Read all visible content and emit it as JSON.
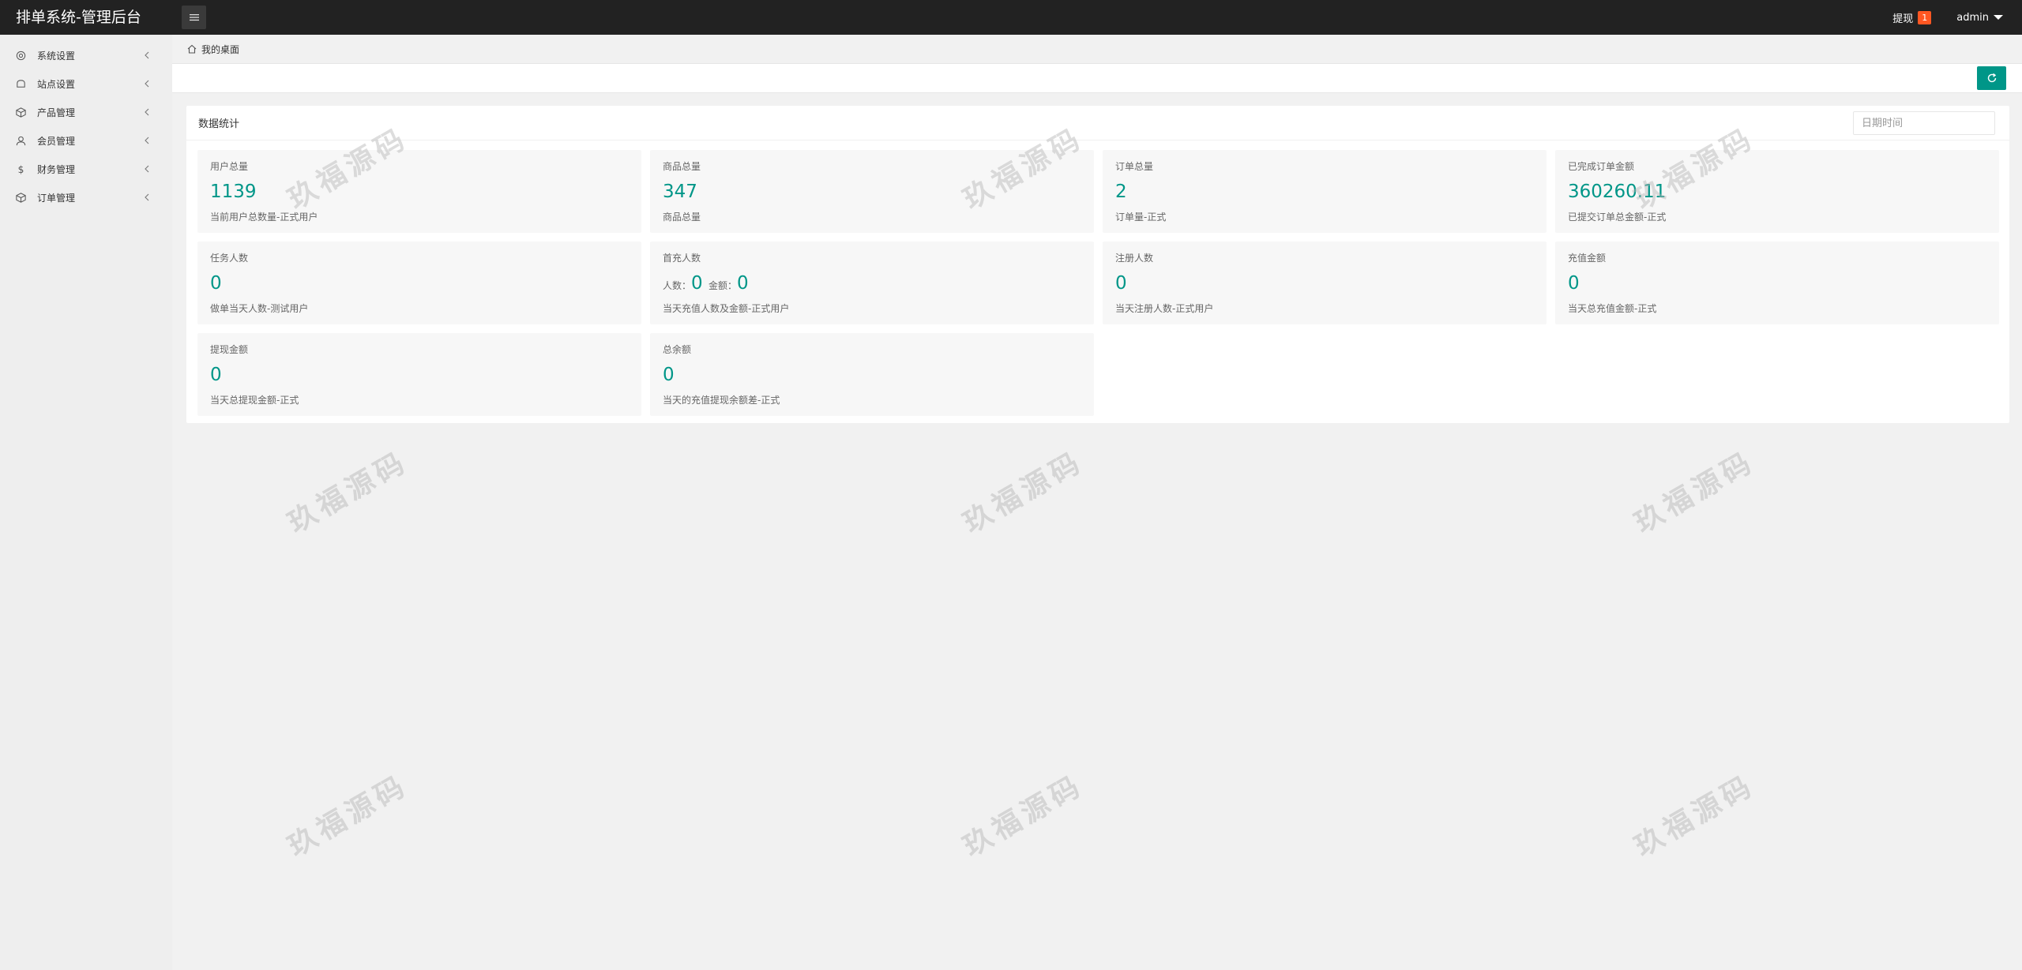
{
  "header": {
    "title": "排单系统-管理后台",
    "withdraw_label": "提现",
    "withdraw_badge": "1",
    "user": "admin"
  },
  "sidebar": {
    "items": [
      {
        "label": "系统设置",
        "icon": "gear-icon"
      },
      {
        "label": "站点设置",
        "icon": "site-icon"
      },
      {
        "label": "产品管理",
        "icon": "box-icon"
      },
      {
        "label": "会员管理",
        "icon": "user-icon"
      },
      {
        "label": "财务管理",
        "icon": "dollar-icon"
      },
      {
        "label": "订单管理",
        "icon": "cube-icon"
      }
    ]
  },
  "breadcrumb": {
    "home": "我的桌面"
  },
  "panel": {
    "title": "数据统计",
    "date_placeholder": "日期时间"
  },
  "stats": [
    {
      "title": "用户总量",
      "value": "1139",
      "desc": "当前用户总数量-正式用户"
    },
    {
      "title": "商品总量",
      "value": "347",
      "desc": "商品总量"
    },
    {
      "title": "订单总量",
      "value": "2",
      "desc": "订单量-正式"
    },
    {
      "title": "已完成订单金额",
      "value": "360260.11",
      "desc": "已提交订单总金额-正式"
    },
    {
      "title": "任务人数",
      "value": "0",
      "desc": "做单当天人数-测试用户"
    },
    {
      "title": "首充人数",
      "count_label": "人数：",
      "count": "0",
      "amount_label": "金额：",
      "amount": "0",
      "desc": "当天充值人数及金额-正式用户"
    },
    {
      "title": "注册人数",
      "value": "0",
      "desc": "当天注册人数-正式用户"
    },
    {
      "title": "充值金额",
      "value": "0",
      "desc": "当天总充值金额-正式"
    },
    {
      "title": "提现金额",
      "value": "0",
      "desc": "当天总提现金额-正式"
    },
    {
      "title": "总余额",
      "value": "0",
      "desc": "当天的充值提现余额差-正式"
    }
  ],
  "watermark": "玖福源码",
  "colors": {
    "accent": "#009688",
    "header_bg": "#222222",
    "badge": "#ff5722"
  }
}
